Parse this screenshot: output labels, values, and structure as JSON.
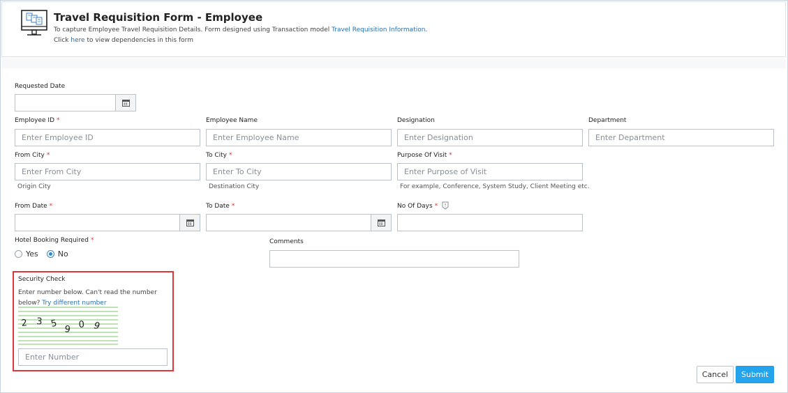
{
  "header": {
    "title": "Travel Requisition Form - Employee",
    "desc_prefix": "To capture Employee Travel Requisition Details. Form designed using Transaction model ",
    "desc_link": "Travel Requisition Information",
    "desc_suffix": ".",
    "click_prefix": "Click ",
    "click_link": "here",
    "click_suffix": " to view dependencies in this form",
    "icon": "monitor-forms-icon"
  },
  "fields": {
    "requested_date": {
      "label": "Requested Date",
      "value": ""
    },
    "employee_id": {
      "label": "Employee ID",
      "required": "*",
      "placeholder": "Enter Employee ID"
    },
    "employee_name": {
      "label": "Employee Name",
      "placeholder": "Enter Employee Name"
    },
    "designation": {
      "label": "Designation",
      "placeholder": "Enter Designation"
    },
    "department": {
      "label": "Department",
      "placeholder": "Enter Department"
    },
    "from_city": {
      "label": "From City",
      "required": "*",
      "placeholder": "Enter From City",
      "help": "Origin City"
    },
    "to_city": {
      "label": "To City",
      "required": "*",
      "placeholder": "Enter To City",
      "help": "Destination City"
    },
    "purpose": {
      "label": "Purpose Of Visit",
      "required": "*",
      "placeholder": "Enter Purpose of Visit",
      "help": "For example, Conference, System Study, Client Meeting etc."
    },
    "from_date": {
      "label": "From Date",
      "required": "*",
      "value": ""
    },
    "to_date": {
      "label": "To Date",
      "required": "*",
      "value": ""
    },
    "no_of_days": {
      "label": "No Of Days",
      "required": "*",
      "value": ""
    },
    "hotel_booking": {
      "label": "Hotel Booking Required",
      "required": "*",
      "options": [
        "Yes",
        "No"
      ],
      "selected": "No"
    },
    "comments": {
      "label": "Comments",
      "value": ""
    }
  },
  "security": {
    "title": "Security Check",
    "text": "Enter number below. Can't read the number below? ",
    "link": "Try different number",
    "captcha_digits": [
      "2",
      "3",
      "5",
      "9",
      "0",
      "9"
    ],
    "placeholder": "Enter Number"
  },
  "actions": {
    "cancel": "Cancel",
    "submit": "Submit"
  },
  "colors": {
    "accent": "#24a4ec",
    "link": "#2a6fb0",
    "required": "#d9342b",
    "security_border": "#e0363a",
    "captcha_lines": "#7cc46a"
  }
}
